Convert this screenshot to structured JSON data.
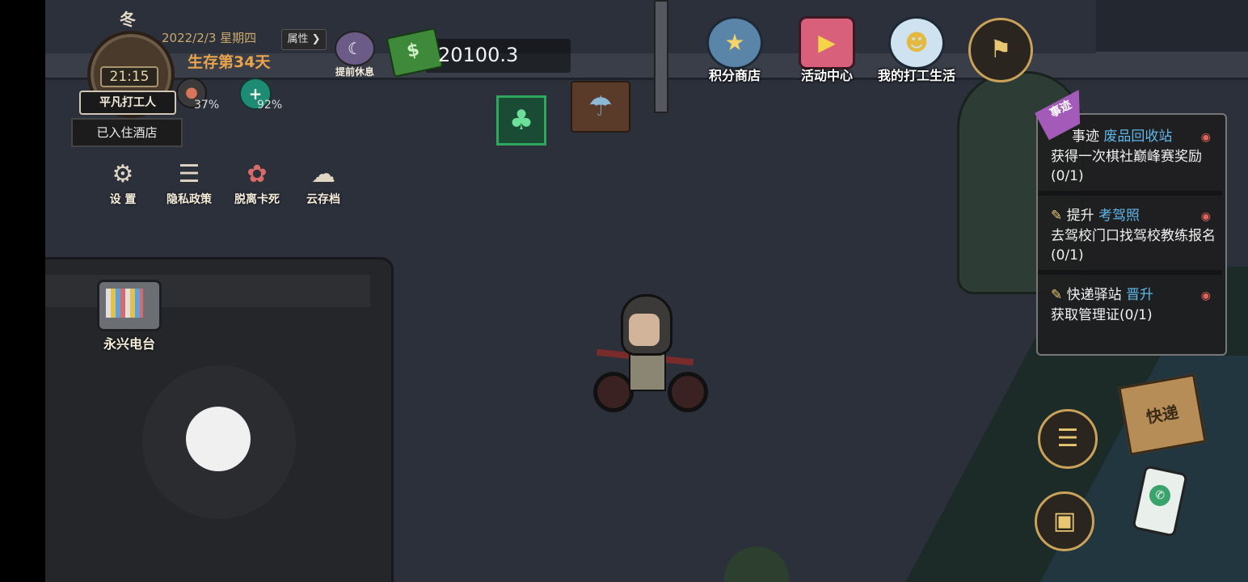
{
  "hud": {
    "season": "冬",
    "time": "21:15",
    "rank": "平凡打工人",
    "date": "2022/2/3 星期四",
    "survival_days": "生存第34天",
    "attributes_label": "属性",
    "rest_label": "提前休息",
    "hunger_pct": "37%",
    "health_pct": "92%",
    "hotel_status": "已入住酒店",
    "money": "20100.3"
  },
  "menu": {
    "settings": "设 置",
    "privacy": "隐私政策",
    "unstuck": "脱离卡死",
    "cloud_save": "云存档"
  },
  "top_buttons": {
    "points_shop": "积分商店",
    "activity_center": "活动中心",
    "my_work_life": "我的打工生活"
  },
  "map": {
    "radio_station": "永兴电台"
  },
  "quests": [
    {
      "tag": "事迹",
      "prefix": "事迹",
      "highlight": "废品回收站",
      "body": "获得一次棋社巅峰赛奖励(0/1)"
    },
    {
      "prefix": "提升",
      "highlight": "考驾照",
      "body": "去驾校门口找驾校教练报名(0/1)"
    },
    {
      "prefix": "快递驿站",
      "highlight": "晋升",
      "body": "获取管理证(0/1)"
    }
  ],
  "side_buttons": {
    "parcel_label": "快递"
  },
  "colors": {
    "accent_gold": "#caa25a",
    "quest_highlight": "#5fb7ea",
    "days_orange": "#e8a34c"
  }
}
